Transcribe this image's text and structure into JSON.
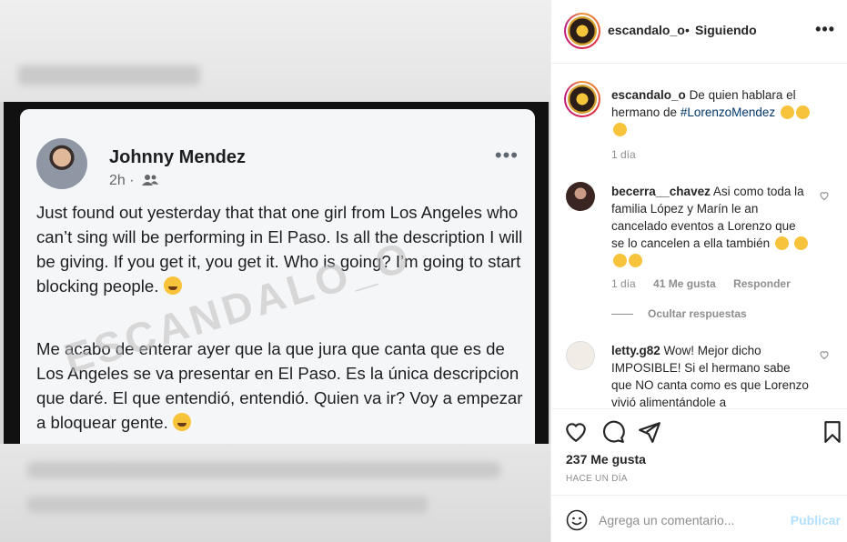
{
  "post_image": {
    "author_name": "Johnny Mendez",
    "time": "2h ·",
    "more": "•••",
    "text_en": "Just found out yesterday that that one girl from Los Angeles who can’t sing will be performing in El Paso. Is all the description I will be giving. If you get it, you get it. Who is going? I’m going to start blocking people.",
    "text_es": "Me acabo de enterar ayer que la que jura que canta que es de Los Angeles se va presentar en El Paso. Es la única descripcion que daré. El que entendió, entendió. Quien va ir? Voy a empezar a bloquear gente.",
    "watermark": "ESCANDALO_O"
  },
  "header": {
    "username": "escandalo_o",
    "separator": "•",
    "follow_status": "Siguiendo",
    "more": "•••"
  },
  "caption": {
    "username": "escandalo_o",
    "text": "De quien hablara el hermano de",
    "hashtag": "#LorenzoMendez",
    "time": "1 día"
  },
  "comments": [
    {
      "username": "becerra__chavez",
      "text": "Asi como toda la familia López y Marín le an cancelado eventos a Lorenzo que se lo cancelen a ella también",
      "time": "1 día",
      "likes": "41 Me gusta",
      "reply": "Responder",
      "hide_replies": "Ocultar respuestas"
    },
    {
      "username": "letty.g82",
      "text": "Wow! Mejor dicho IMPOSIBLE! Si el hermano sabe que NO canta como es que Lorenzo vivió alimentándole a"
    }
  ],
  "actions": {
    "likes": "237 Me gusta",
    "time_ago": "HACE UN DÍA"
  },
  "add_comment": {
    "placeholder": "Agrega un comentario...",
    "publish": "Publicar"
  },
  "colors": {
    "link": "#00376b",
    "publish_disabled": "#b2dffc",
    "meta": "#8e8e8e"
  }
}
